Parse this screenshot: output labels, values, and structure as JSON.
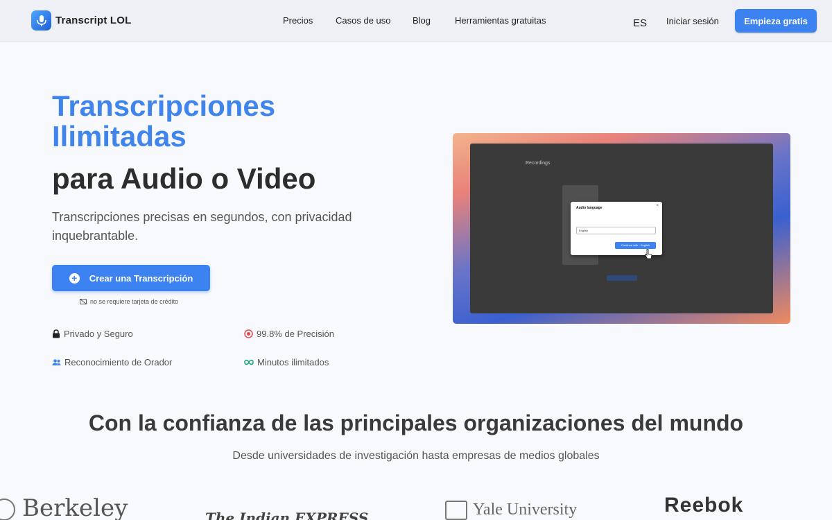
{
  "header": {
    "brand": "Transcript LOL",
    "nav": [
      "Precios",
      "Casos de uso",
      "Blog",
      "Herramientas gratuitas"
    ],
    "lang": "ES",
    "login": "Iniciar sesión",
    "cta": "Empieza gratis"
  },
  "hero": {
    "title_line1": "Transcripciones",
    "title_line2": "Ilimitadas",
    "title_line3": "para Audio o Video",
    "subtitle": "Transcripciones precisas en segundos, con privacidad inquebrantable.",
    "cta": "Crear una Transcripción",
    "no_card": "no se requiere tarjeta de crédito",
    "features": [
      {
        "label": "Privado y Seguro",
        "icon": "lock-icon"
      },
      {
        "label": "99.8% de Precisión",
        "icon": "target-icon"
      },
      {
        "label": "Reconocimiento de Orador",
        "icon": "users-icon"
      },
      {
        "label": "Minutos ilimitados",
        "icon": "infinity-icon"
      }
    ]
  },
  "preview": {
    "heading": "Recordings",
    "dialog_title": "Audio language",
    "dialog_select": "English",
    "dialog_button": "Continue with · English"
  },
  "trust": {
    "title": "Con la confianza de las principales organizaciones del mundo",
    "subtitle": "Desde universidades de investigación hasta empresas de medios globales",
    "brands": [
      "Berkeley",
      "The Indian EXPRESS",
      "Yale University",
      "Reebok"
    ]
  },
  "colors": {
    "accent": "#3c82f0",
    "title_blue": "#3f85ec"
  }
}
